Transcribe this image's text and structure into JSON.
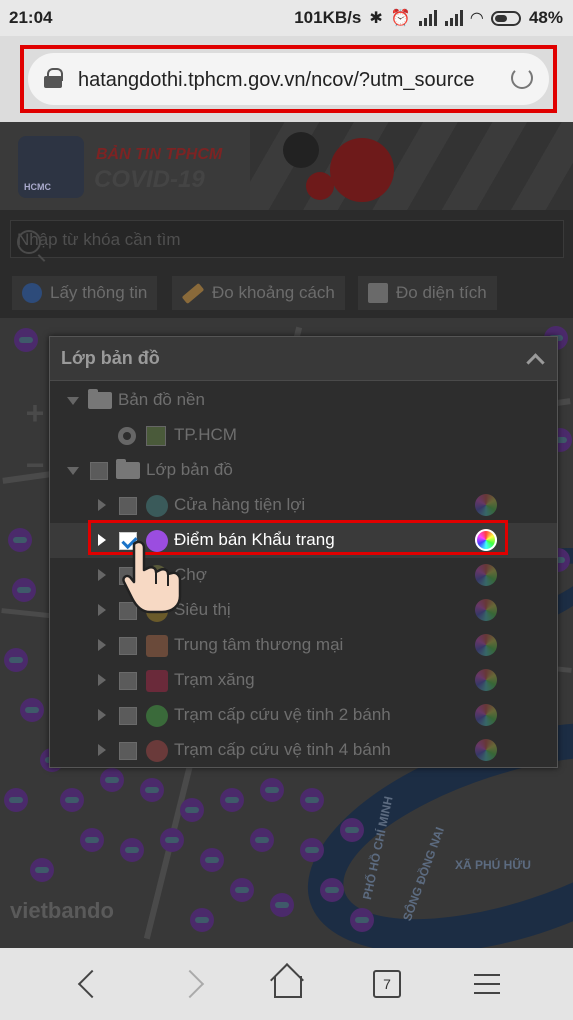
{
  "status_bar": {
    "time": "21:04",
    "network_speed": "101KB/s",
    "battery": "48%"
  },
  "browser": {
    "url": "hatangdothi.tphcm.gov.vn/ncov/?utm_source",
    "tab_count": "7"
  },
  "banner": {
    "logo_text": "HCMC",
    "title_top": "BẢN TIN TPHCM",
    "title_bottom": "COVID-19"
  },
  "search": {
    "placeholder": "Nhập từ khóa cần tìm"
  },
  "toolbar": {
    "info_label": "Lấy thông tin",
    "distance_label": "Đo khoảng cách",
    "area_label": "Đo diện tích"
  },
  "map": {
    "watermark": "vietbando",
    "place_1": "XÃ PHÚ HỮU",
    "place_2": "PHỐ HỒ CHÍ MINH",
    "place_3": "SÔNG ĐỒNG NAI"
  },
  "layer_panel": {
    "title": "Lớp bản đồ",
    "base_group": "Bản đồ nền",
    "base_item": "TP.HCM",
    "layer_group": "Lớp bản đồ",
    "layers": [
      "Cửa hàng tiện lợi",
      "Điểm bán Khẩu trang",
      "Chợ",
      "Siêu thị",
      "Trung tâm thương mại",
      "Trạm xăng",
      "Trạm cấp cứu vệ tinh 2 bánh",
      "Trạm cấp cứu vệ tinh 4 bánh"
    ]
  },
  "colors": {
    "highlight": "#e00000",
    "checkbox_tick": "#1a73c8"
  }
}
